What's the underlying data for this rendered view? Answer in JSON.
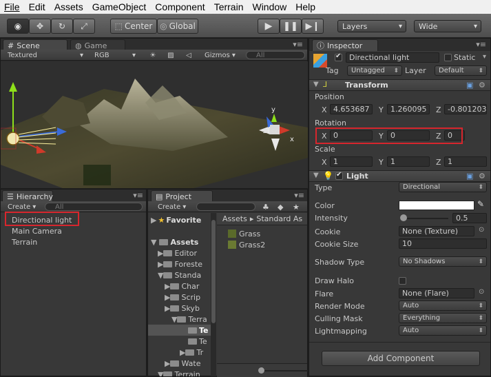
{
  "menu": [
    "File",
    "Edit",
    "Assets",
    "GameObject",
    "Component",
    "Terrain",
    "Window",
    "Help"
  ],
  "toolbar": {
    "center": "Center",
    "global": "Global",
    "layers": "Layers",
    "layout": "Wide"
  },
  "scene": {
    "tab": "Scene",
    "game_tab": "Game",
    "shading": "Textured",
    "render": "RGB",
    "gizmos": "Gizmos",
    "search": "All",
    "iso": "Iso",
    "axis_y": "y",
    "axis_x": "x"
  },
  "hierarchy": {
    "tab": "Hierarchy",
    "create": "Create",
    "search": "All",
    "items": [
      "Directional light",
      "Main Camera",
      "Terrain"
    ]
  },
  "project": {
    "tab": "Project",
    "create": "Create",
    "favorites": "Favorite",
    "assets": "Assets",
    "breadcrumb": [
      "Assets",
      "Standard As"
    ],
    "tree": [
      "Editor",
      "Foreste",
      "Standa",
      "Char",
      "Scrip",
      "Skyb",
      "Terra",
      "Te",
      "Te",
      "Tr",
      "Wate",
      "Terrain"
    ],
    "files": [
      "Grass",
      "Grass2"
    ]
  },
  "inspector": {
    "tab": "Inspector",
    "object_name": "Directional light",
    "static": "Static",
    "tag_label": "Tag",
    "tag": "Untagged",
    "layer_label": "Layer",
    "layer": "Default",
    "transform": {
      "title": "Transform",
      "position_label": "Position",
      "rotation_label": "Rotation",
      "scale_label": "Scale",
      "position": {
        "x": "4.653687",
        "y": "1.260095",
        "z": "-0.801203"
      },
      "rotation": {
        "x": "0",
        "y": "0",
        "z": "0"
      },
      "scale": {
        "x": "1",
        "y": "1",
        "z": "1"
      }
    },
    "light": {
      "title": "Light",
      "type_label": "Type",
      "type": "Directional",
      "color_label": "Color",
      "intensity_label": "Intensity",
      "intensity": "0.5",
      "cookie_label": "Cookie",
      "cookie": "None (Texture)",
      "cookie_size_label": "Cookie Size",
      "cookie_size": "10",
      "shadow_label": "Shadow Type",
      "shadow": "No Shadows",
      "halo_label": "Draw Halo",
      "flare_label": "Flare",
      "flare": "None (Flare)",
      "render_mode_label": "Render Mode",
      "render_mode": "Auto",
      "culling_label": "Culling Mask",
      "culling": "Everything",
      "lightmapping_label": "Lightmapping",
      "lightmapping": "Auto"
    },
    "add_component": "Add Component",
    "axes": {
      "x": "X",
      "y": "Y",
      "z": "Z"
    }
  }
}
